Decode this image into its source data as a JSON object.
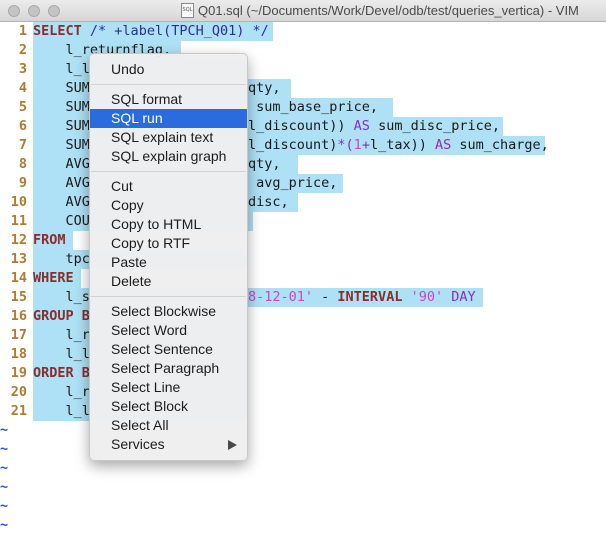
{
  "window": {
    "title": "Q01.sql (~/Documents/Work/Devel/odb/test/queries_vertica) - VIM",
    "file_icon": "sql-file-icon"
  },
  "editor": {
    "lines": [
      {
        "n": "1",
        "parts": [
          {
            "c": "kw",
            "t": "SELECT"
          },
          {
            "c": "",
            "t": " "
          },
          {
            "c": "cm",
            "t": "/* +label(TPCH_Q01) */"
          }
        ]
      },
      {
        "n": "2",
        "parts": [
          {
            "c": "",
            "t": "    l_returnflag,"
          }
        ]
      },
      {
        "n": "3",
        "parts": [
          {
            "c": "",
            "t": "    l_l"
          }
        ]
      },
      {
        "n": "4",
        "parts": [
          {
            "c": "",
            "t": "    SUM"
          }
        ]
      },
      {
        "n": "5",
        "parts": [
          {
            "c": "",
            "t": "    SUM"
          }
        ]
      },
      {
        "n": "6",
        "parts": [
          {
            "c": "",
            "t": "    SUM"
          }
        ]
      },
      {
        "n": "7",
        "parts": [
          {
            "c": "",
            "t": "    SUM"
          }
        ]
      },
      {
        "n": "8",
        "parts": [
          {
            "c": "",
            "t": "    AVG"
          }
        ]
      },
      {
        "n": "9",
        "parts": [
          {
            "c": "",
            "t": "    AVG"
          }
        ]
      },
      {
        "n": "10",
        "parts": [
          {
            "c": "",
            "t": "    AVG"
          }
        ]
      },
      {
        "n": "11",
        "parts": [
          {
            "c": "",
            "t": "    COU"
          }
        ]
      },
      {
        "n": "12",
        "parts": [
          {
            "c": "kw",
            "t": "FROM"
          }
        ]
      },
      {
        "n": "13",
        "parts": [
          {
            "c": "",
            "t": "    tpc"
          }
        ]
      },
      {
        "n": "14",
        "parts": [
          {
            "c": "kw",
            "t": "WHERE"
          }
        ]
      },
      {
        "n": "15",
        "parts": [
          {
            "c": "",
            "t": "    l_s"
          }
        ]
      },
      {
        "n": "16",
        "parts": [
          {
            "c": "kw",
            "t": "GROUP B"
          }
        ]
      },
      {
        "n": "17",
        "parts": [
          {
            "c": "",
            "t": "    l_r"
          }
        ]
      },
      {
        "n": "18",
        "parts": [
          {
            "c": "",
            "t": "    l_l"
          }
        ]
      },
      {
        "n": "19",
        "parts": [
          {
            "c": "kw",
            "t": "ORDER B"
          }
        ]
      },
      {
        "n": "20",
        "parts": [
          {
            "c": "",
            "t": "    l_r"
          }
        ]
      },
      {
        "n": "21",
        "parts": [
          {
            "c": "",
            "t": "    l_l"
          }
        ]
      }
    ],
    "right_fragments": {
      "line4": "qty,",
      "line5": " sum_base_price,",
      "line6": "l_discount)) ",
      "line6_as": "AS",
      "line6_tail": " sum_disc_price,",
      "line7": "l_discount)",
      "line7_op": "*(",
      "line7_num": "1",
      "line7_op2": "+",
      "line7_mid": "l_tax)) ",
      "line7_as": "AS",
      "line7_tail": " sum_charge,",
      "line8": "qty,",
      "line9": " avg_price,",
      "line10": "disc,",
      "line15_date": "8-12-01'",
      "line15_minus": " - ",
      "line15_interval": "INTERVAL",
      "line15_num": " '90'",
      "line15_day": " DAY"
    },
    "tilde": "~"
  },
  "context_menu": {
    "groups": [
      [
        "Undo"
      ],
      [
        "SQL format",
        "SQL run",
        "SQL explain text",
        "SQL explain graph"
      ],
      [
        "Cut",
        "Copy",
        "Copy to HTML",
        "Copy to RTF",
        "Paste",
        "Delete"
      ],
      [
        "Select Blockwise",
        "Select Word",
        "Select Sentence",
        "Select Paragraph",
        "Select Line",
        "Select Block",
        "Select All",
        "Services"
      ]
    ],
    "highlighted": "SQL run",
    "submenu_item": "Services"
  }
}
